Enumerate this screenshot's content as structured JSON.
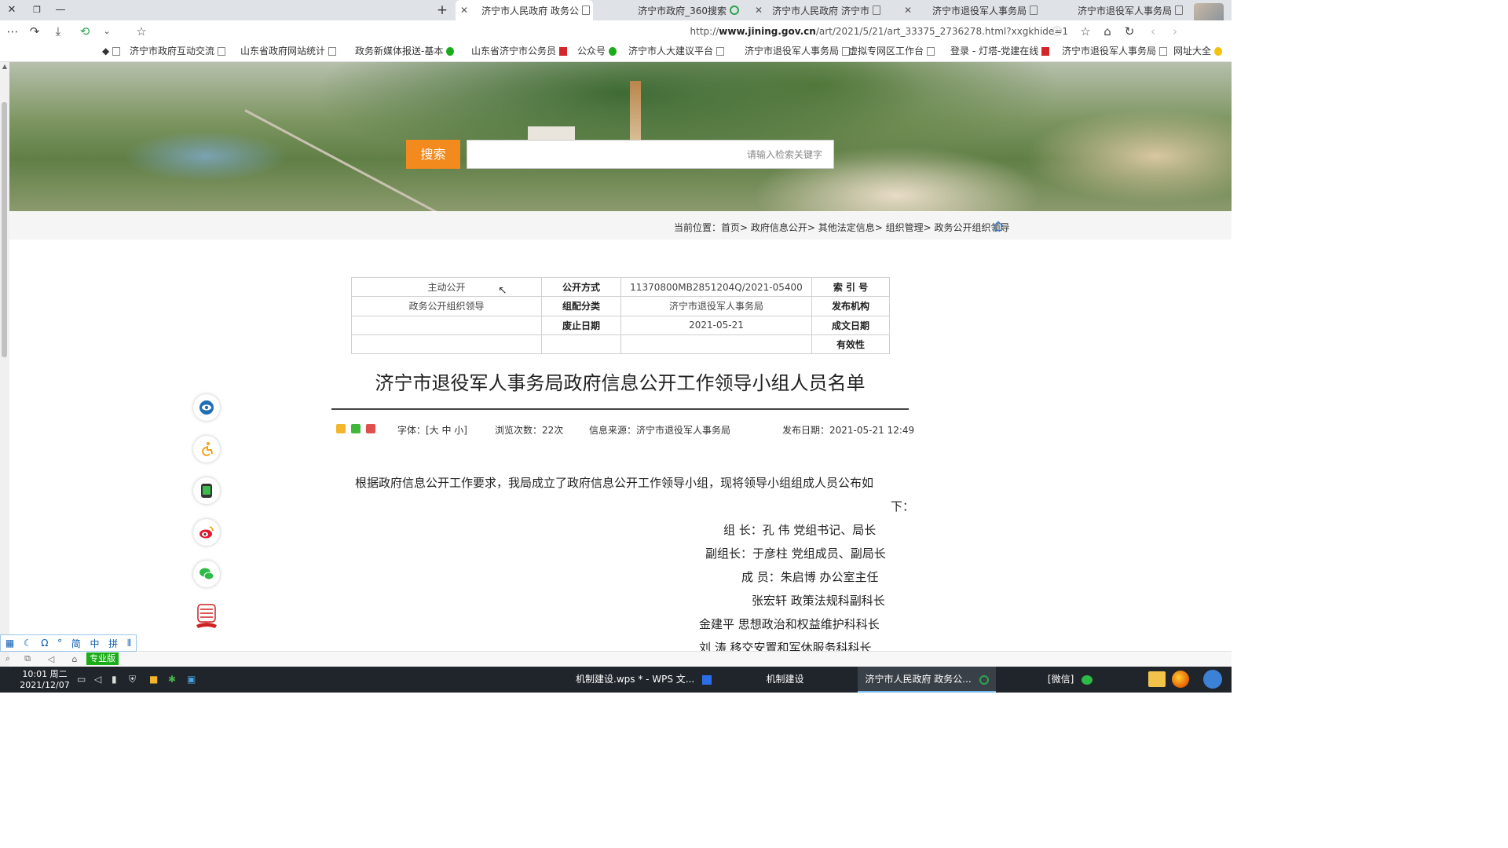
{
  "browser": {
    "tabs": [
      {
        "title": "济宁市退役军人事务局"
      },
      {
        "title": "济宁市退役军人事务局"
      },
      {
        "title": "济宁市人民政府 济宁市"
      },
      {
        "title": "济宁市政府_360搜索"
      },
      {
        "title": "济宁市人民政府 政务公"
      }
    ],
    "new_tab": "+",
    "url_prefix": "http://",
    "url_host": "www.jining.gov.cn",
    "url_path": "/art/2021/5/21/art_33375_2736278.html?xxgkhide=1",
    "bookmarks": [
      {
        "label": "网址大全"
      },
      {
        "label": "济宁市退役军人事务局"
      },
      {
        "label": "登录 - 灯塔-党建在线"
      },
      {
        "label": "虚拟专网区工作台"
      },
      {
        "label": "济宁市退役军人事务局"
      },
      {
        "label": "济宁市人大建议平台"
      },
      {
        "label": "公众号"
      },
      {
        "label": "山东省济宁市公务员"
      },
      {
        "label": "政务新媒体报送-基本"
      },
      {
        "label": "山东省政府网站统计"
      },
      {
        "label": "济宁市政府互动交流"
      }
    ]
  },
  "banner": {
    "search_placeholder": "请输入检索关键字",
    "search_button": "搜索"
  },
  "breadcrumb": {
    "text": "当前位置：首页> 政府信息公开> 其他法定信息> 组织管理> 政务公开组织领导"
  },
  "meta": {
    "rows": [
      {
        "k1": "索 引 号",
        "v1": "11370800MB2851204Q/2021-05400",
        "k2": "公开方式",
        "v2": "主动公开"
      },
      {
        "k1": "发布机构",
        "v1": "济宁市退役军人事务局",
        "k2": "组配分类",
        "v2": "政务公开组织领导"
      },
      {
        "k1": "成文日期",
        "v1": "2021-05-21",
        "k2": "废止日期",
        "v2": ""
      },
      {
        "k1": "有效性",
        "v1": "",
        "k2": "",
        "v2": ""
      }
    ]
  },
  "article": {
    "title": "济宁市退役军人事务局政府信息公开工作领导小组人员名单",
    "publish_date": "发布日期：2021-05-21 12:49",
    "source": "信息来源：济宁市退役军人事务局",
    "views": "浏览次数：22次",
    "font_size": "字体：[大 中 小]",
    "para1_line1": "根据政府信息公开工作要求，我局成立了政府信息公开工作领导小组，现将领导小组组成人员公布如",
    "para1_line2": "下：",
    "line_leader": "组  长：孔  伟  党组书记、局长",
    "line_deputy": "副组长：于彦柱  党组成员、副局长",
    "line_member1": "成  员：朱启博  办公室主任",
    "line_member2": "张宏轩  政策法规科副科长",
    "line_member3": "金建平  思想政治和权益维护科科长",
    "line_member4": "刘  涛  移交安置和军休服务科科长"
  },
  "ime": {
    "items": [
      "拼",
      "中",
      "简",
      "°",
      "Ω",
      "☾"
    ],
    "pro_label": "专业版"
  },
  "taskbar": {
    "items": [
      {
        "label": "[微信]"
      },
      {
        "label": "济宁市人民政府 政务公..."
      },
      {
        "label": "机制建设"
      },
      {
        "label": "机制建设.wps * - WPS 文..."
      }
    ],
    "clock_time": "10:01 周二",
    "clock_date": "2021/12/07"
  }
}
